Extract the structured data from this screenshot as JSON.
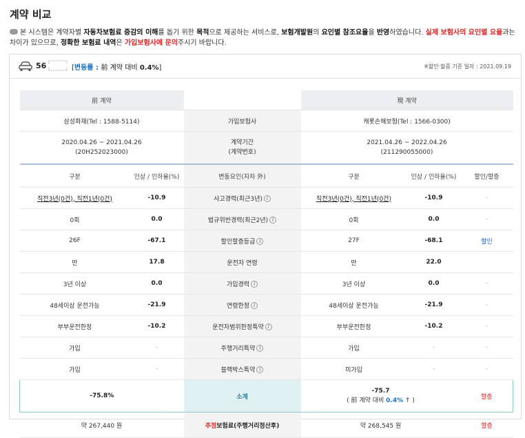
{
  "page": {
    "title": "계약 비교",
    "notice": {
      "p1": "본 시스템은 계약자별 ",
      "b1": "자동차보험료 증감의 이해",
      "p2": "를 돕기 위한 ",
      "b2": "목적",
      "p3": "으로 제공하는 서비스로, ",
      "b3": "보험개발원",
      "p4": "의 ",
      "b4": "요인별 참조요율",
      "p5": "을 ",
      "b5": "반영",
      "p6": "하였습니다. ",
      "red1": "실제 보험사의 요인별 요율",
      "p7": "과는 차이가 있으므로, ",
      "b6": "정확한 보험료 내역",
      "p8": "은 ",
      "red2": "가입보험사에 문의",
      "p9": "주시기 바랍니다."
    }
  },
  "summary_bar": {
    "car_number": "56",
    "rate_open": "[",
    "rate_label": "변동률 : ",
    "rate_prefix": "前 계약 대비 ",
    "rate_value": "0.4%",
    "rate_close": "]",
    "basis_date": "※할인·할증 기준 일자 : 2021.09.19"
  },
  "table": {
    "prev_header": "前 계약",
    "curr_header": "現 계약",
    "insurer_label": "가입보험사",
    "prev_insurer": "삼성화재(Tel : 1588-5114)",
    "curr_insurer": "캐롯손해보험(Tel : 1566-0300)",
    "period_label_1": "계약기간",
    "period_label_2": "(계약번호)",
    "prev_period": "2020.04.26 ~ 2021.04.26",
    "prev_contract_no": "(20H252023000)",
    "curr_period": "2021.04.26 ~ 2022.04.26",
    "curr_contract_no": "(211290055000)",
    "col_category": "구분",
    "col_rate": "인상 / 인하율(%)",
    "col_factor": "변동요인(자차 外)",
    "col_discount": "할인/할증",
    "rows": [
      {
        "prev": "직전3년(0건), 직전1년(0건)",
        "prev_rate": "-10.9",
        "factor": "사고경력(최근3년)",
        "curr": "직전3년(0건), 직전1년(0건)",
        "curr_rate": "-10.9",
        "disc": "-"
      },
      {
        "prev": "0회",
        "prev_rate": "0.0",
        "factor": "법규위반경력(최근2년)",
        "curr": "0회",
        "curr_rate": "0.0",
        "disc": "-"
      },
      {
        "prev": "26F",
        "prev_rate": "-67.1",
        "factor": "할인할증등급",
        "curr": "27F",
        "curr_rate": "-68.1",
        "disc": "할인"
      },
      {
        "prev": "만",
        "prev_rate": "17.8",
        "factor": "운전자 연령",
        "curr": "만",
        "curr_rate": "22.0",
        "disc": ""
      },
      {
        "prev": "3년 이상",
        "prev_rate": "0.0",
        "factor": "가입경력",
        "curr": "3년 이상",
        "curr_rate": "0.0",
        "disc": "-"
      },
      {
        "prev": "48세이상 운전가능",
        "prev_rate": "-21.9",
        "factor": "연령한정",
        "curr": "48세이상 운전가능",
        "curr_rate": "-21.9",
        "disc": "-"
      },
      {
        "prev": "부부운전한정",
        "prev_rate": "-10.2",
        "factor": "운전자범위한정특약",
        "curr": "부부운전한정",
        "curr_rate": "-10.2",
        "disc": "-"
      },
      {
        "prev": "가입",
        "prev_rate": "-",
        "factor": "주행거리특약",
        "curr": "가입",
        "curr_rate": "-",
        "disc": "-"
      },
      {
        "prev": "가입",
        "prev_rate": "-",
        "factor": "블랙박스특약",
        "curr": "미가입",
        "curr_rate": "-",
        "disc": "-"
      }
    ],
    "subtotal_label": "소계",
    "prev_subtotal": "-75.8%",
    "curr_subtotal": "-75.7",
    "curr_subtotal_open": "( 前 계약 대비 ",
    "curr_subtotal_pct": "0.4%",
    "curr_subtotal_close": " ↑ )",
    "curr_subtotal_disc": "할증",
    "premium_accent": "추정",
    "premium_label": "보험료(주행거리정산후)",
    "prev_premium": "약 267,440 원",
    "curr_premium": "약 268,545 원",
    "premium_disc": "할증"
  },
  "colors": {
    "accent_blue": "#1a73c8",
    "accent_red": "#e02424",
    "subtotal_teal": "#def0f1"
  },
  "icons": {
    "car": "car-icon",
    "info": "info-icon",
    "bullet": "speech-bubble-icon"
  }
}
